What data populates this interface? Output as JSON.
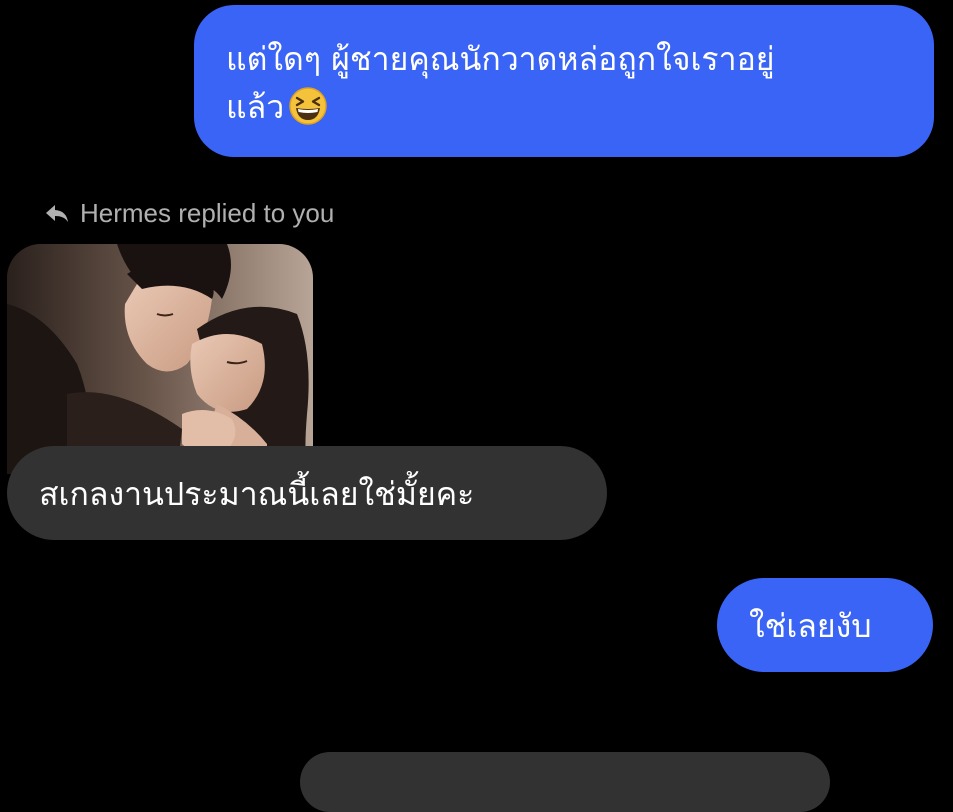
{
  "messages": [
    {
      "direction": "outgoing",
      "lines": [
        "แต่ใดๆ ผู้ชายคุณนักวาดหล่อถูกใจเราอยู่",
        "แล้ว"
      ],
      "emoji": "grinning-squinting-face-emoji"
    },
    {
      "direction": "incoming",
      "reply_label": "Hermes replied to you",
      "reply_icon": "reply-arrow-icon",
      "image": "photo-couple-kissing",
      "text": "สเกลงานประมาณนี้เลยใช่มั้ยคะ"
    },
    {
      "direction": "outgoing",
      "text": "ใช่เลยงับ"
    }
  ],
  "colors": {
    "background": "#000000",
    "outgoing_bubble": "#3a64f5",
    "incoming_bubble": "#323232",
    "text": "#ffffff",
    "meta_text": "#b0b0b0"
  }
}
